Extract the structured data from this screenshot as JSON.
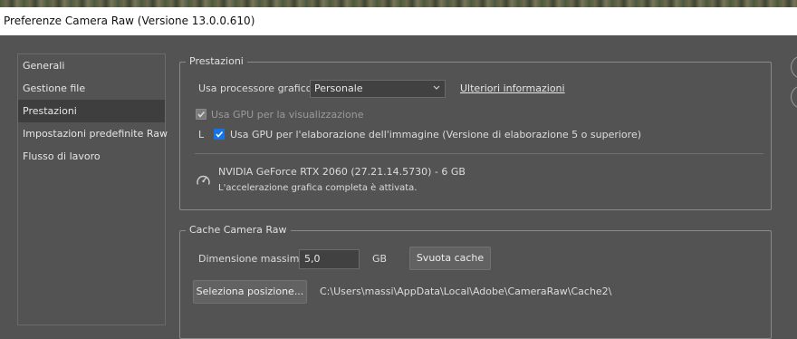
{
  "window": {
    "title": "Preferenze Camera Raw  (Versione 13.0.0.610)"
  },
  "sidebar": {
    "items": [
      {
        "label": "Generali",
        "selected": false
      },
      {
        "label": "Gestione file",
        "selected": false
      },
      {
        "label": "Prestazioni",
        "selected": true
      },
      {
        "label": "Impostazioni predefinite Raw",
        "selected": false
      },
      {
        "label": "Flusso di lavoro",
        "selected": false
      }
    ]
  },
  "performance": {
    "legend": "Prestazioni",
    "gpu_label": "Usa processore grafico:",
    "gpu_value": "Personale",
    "more_info_link": "Ulteriori informazioni",
    "gpu_display_label": "Usa GPU per la visualizzazione",
    "gpu_processing_label": "Usa GPU per l'elaborazione dell'immagine (Versione di elaborazione 5 o superiore)",
    "gpu_processing_prefix": "L",
    "gpu_name": "NVIDIA GeForce RTX 2060 (27.21.14.5730) - 6 GB",
    "gpu_status": "L'accelerazione grafica completa è attivata.",
    "icon": "gauge-icon"
  },
  "cache": {
    "legend": "Cache Camera Raw",
    "max_size_label": "Dimensione massima:",
    "max_size_value": "5,0",
    "unit": "GB",
    "purge_button": "Svuota cache",
    "select_location_button": "Seleziona posizione...",
    "path": "C:\\Users\\massi\\AppData\\Local\\Adobe\\CameraRaw\\Cache2\\"
  },
  "colors": {
    "background": "#535353",
    "checkbox_accent": "#1473e6",
    "selected_nav": "#3e3e3e"
  }
}
